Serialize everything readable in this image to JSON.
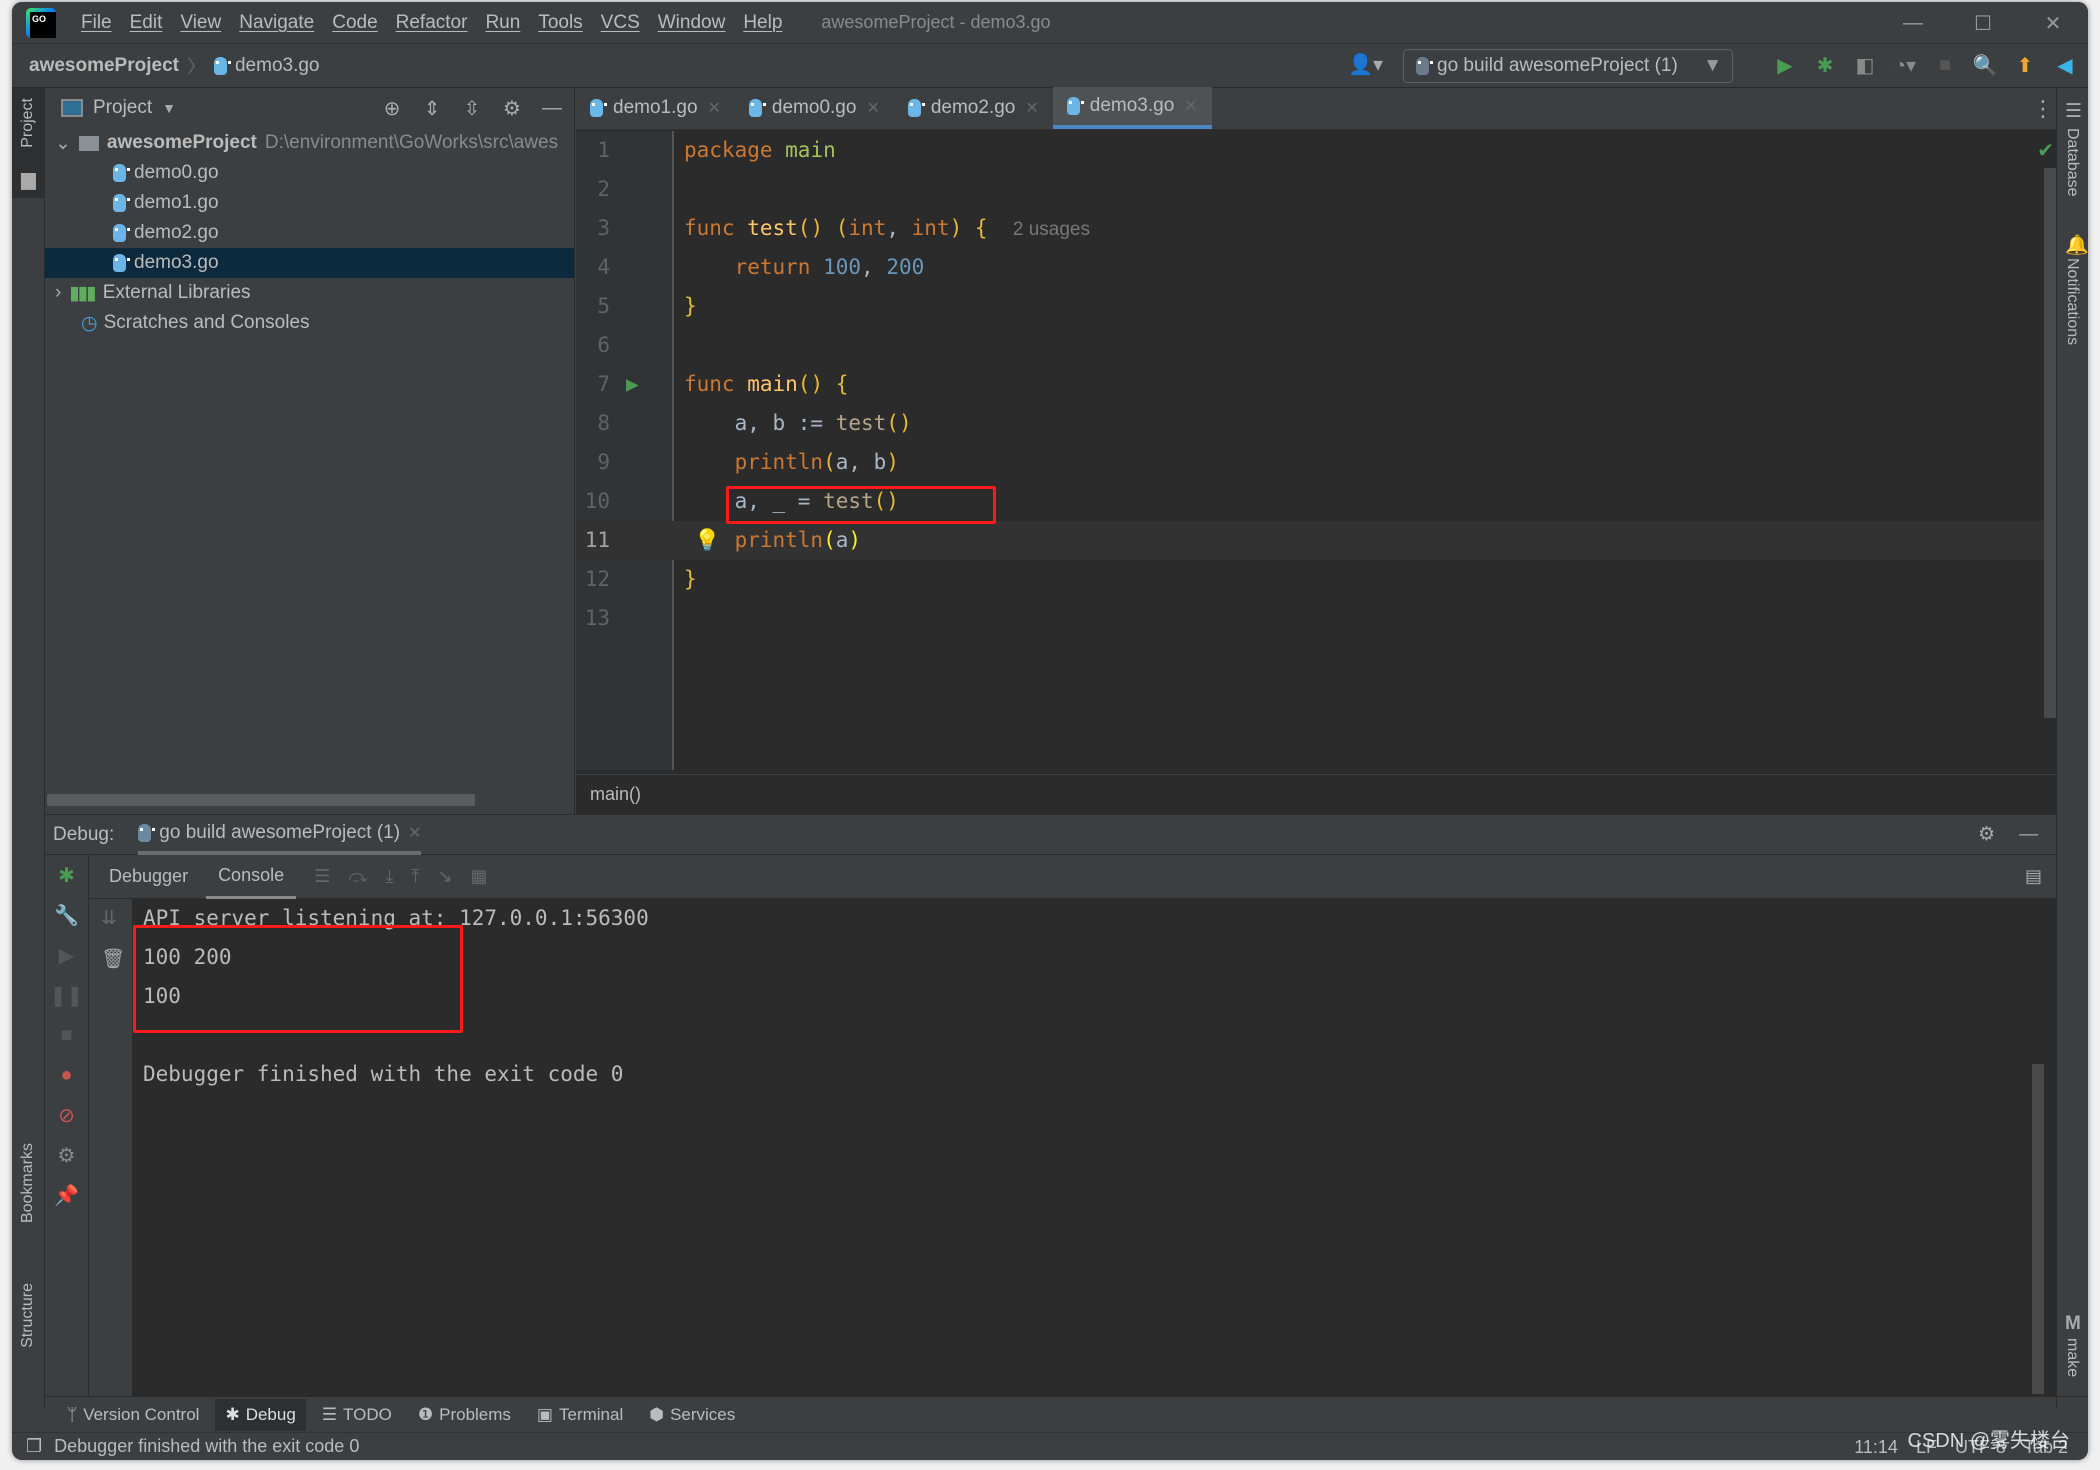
{
  "titlebar": {
    "menu": [
      "File",
      "Edit",
      "View",
      "Navigate",
      "Code",
      "Refactor",
      "Run",
      "Tools",
      "VCS",
      "Window",
      "Help"
    ],
    "title": "awesomeProject - demo3.go"
  },
  "navbar": {
    "project": "awesomeProject",
    "file": "demo3.go",
    "run_config": "go build awesomeProject (1)"
  },
  "sidebar": {
    "left_tabs": [
      "Project",
      "Bookmarks",
      "Structure"
    ],
    "right_tabs": [
      "Database",
      "Notifications",
      "make"
    ]
  },
  "project": {
    "title": "Project",
    "root": "awesomeProject",
    "root_path": "D:\\environment\\GoWorks\\src\\awes",
    "files": [
      "demo0.go",
      "demo1.go",
      "demo2.go",
      "demo3.go"
    ],
    "selected": "demo3.go",
    "external": "External Libraries",
    "scratches": "Scratches and Consoles"
  },
  "editor": {
    "tabs": [
      "demo1.go",
      "demo0.go",
      "demo2.go",
      "demo3.go"
    ],
    "active_tab": "demo3.go",
    "breadcrumb": "main()",
    "usages_hint": "2 usages",
    "line_numbers": [
      "1",
      "2",
      "3",
      "4",
      "5",
      "6",
      "7",
      "8",
      "9",
      "10",
      "11",
      "12",
      "13"
    ]
  },
  "debug": {
    "label": "Debug:",
    "session": "go build awesomeProject (1)",
    "tabs": [
      "Debugger",
      "Console"
    ],
    "active": "Console",
    "output": [
      "API server listening at: 127.0.0.1:56300",
      "100 200",
      "100",
      "",
      "Debugger finished with the exit code 0"
    ]
  },
  "bottom_tabs": [
    "Version Control",
    "Debug",
    "TODO",
    "Problems",
    "Terminal",
    "Services"
  ],
  "status": {
    "message": "Debugger finished with the exit code 0",
    "position": "11:14",
    "line_sep": "LF",
    "encoding": "UTF-8",
    "indent": "Tab 2"
  },
  "watermark": "CSDN @雾失楼台"
}
